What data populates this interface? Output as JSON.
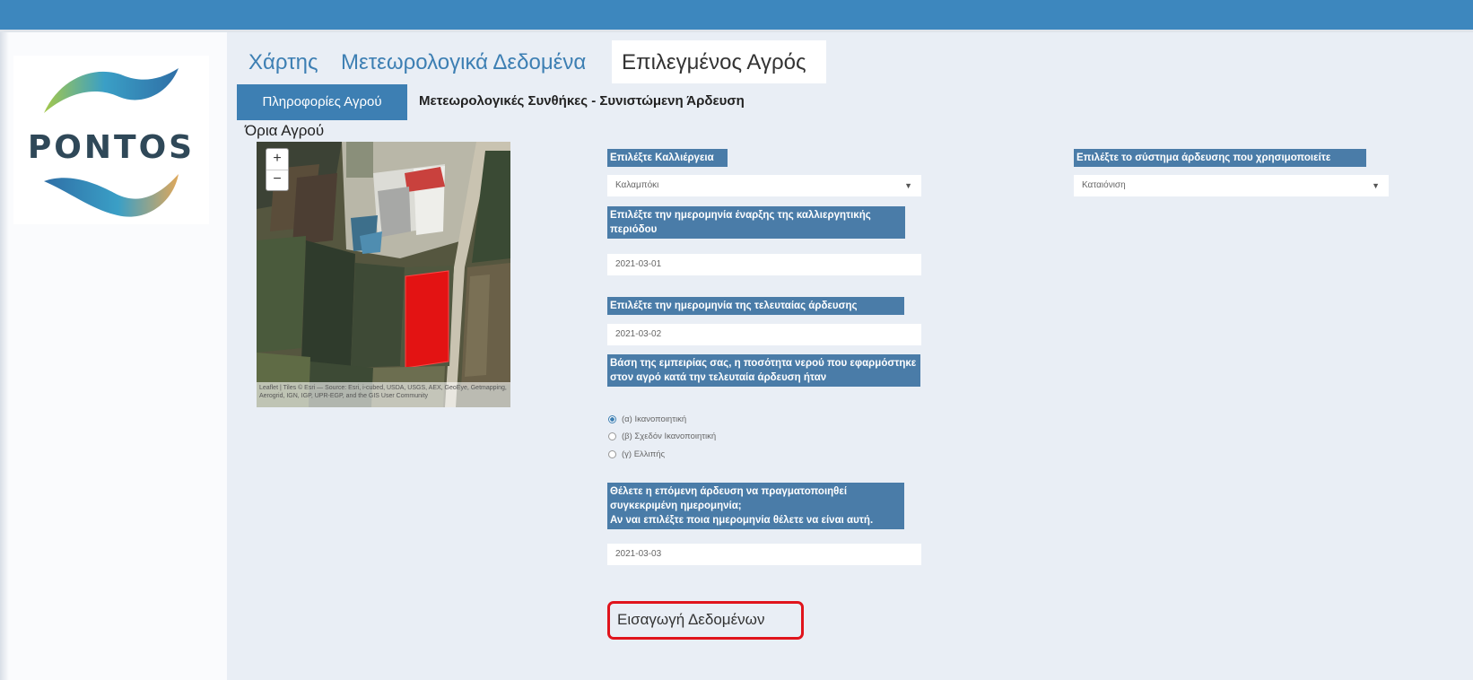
{
  "brand": {
    "logo_text": "PONTOS"
  },
  "colors": {
    "topbar": "#3d87be",
    "accent": "#3d7fb3",
    "label_bg": "#4a7ca8",
    "highlight_outline": "#e0141c"
  },
  "tabs": [
    {
      "label": "Χάρτης",
      "active": false
    },
    {
      "label": "Μετεωρολογικά Δεδομένα",
      "active": false
    },
    {
      "label": "Επιλεγμένος Αγρός",
      "active": true
    }
  ],
  "subtabs": [
    {
      "label": "Πληροφορίες Αγρού",
      "active": true
    },
    {
      "label": "Μετεωρολογικές Συνθήκες - Συνιστώμενη Άρδευση",
      "active": false
    }
  ],
  "map": {
    "title": "Όρια Αγρού",
    "zoom_in": "+",
    "zoom_out": "−",
    "attribution": "Leaflet | Tiles © Esri — Source: Esri, i-cubed, USDA, USGS, AEX, GeoEye, Getmapping, Aerogrid, IGN, IGP, UPR-EGP, and the GIS User Community"
  },
  "form": {
    "crop": {
      "label": "Επιλέξτε Καλλιέργεια",
      "value": "Καλαμπόκι",
      "caret": "▼"
    },
    "irrigation_system": {
      "label": "Επιλέξτε το σύστημα άρδευσης που χρησιμοποιείτε",
      "value": "Καταιόνιση",
      "caret": "▼"
    },
    "start_date": {
      "label": "Επιλέξτε την ημερομηνία έναρξης της καλλιεργητικής περιόδου",
      "value": "2021-03-01"
    },
    "last_irrigation": {
      "label": "Επιλέξτε την ημερομηνία της τελευταίας άρδευσης",
      "value": "2021-03-02"
    },
    "water_amount": {
      "label": "Βάση της εμπειρίας σας, η ποσότητα νερού που εφαρμόστηκε στον αγρό κατά την τελευταία άρδευση ήταν",
      "options": [
        {
          "label": "(α) Ικανοποιητική",
          "checked": true
        },
        {
          "label": "(β) Σχεδόν Ικανοποιητική",
          "checked": false
        },
        {
          "label": "(γ) Ελλιπής",
          "checked": false
        }
      ]
    },
    "next_irrigation": {
      "label_line1": "Θέλετε η επόμενη άρδευση να πραγματοποιηθεί συγκεκριμένη ημερομηνία;",
      "label_line2": "Αν ναι επιλέξτε ποια ημερομηνία θέλετε να είναι αυτή.",
      "value": "2021-03-03"
    },
    "submit_label": "Εισαγωγή Δεδομένων"
  }
}
